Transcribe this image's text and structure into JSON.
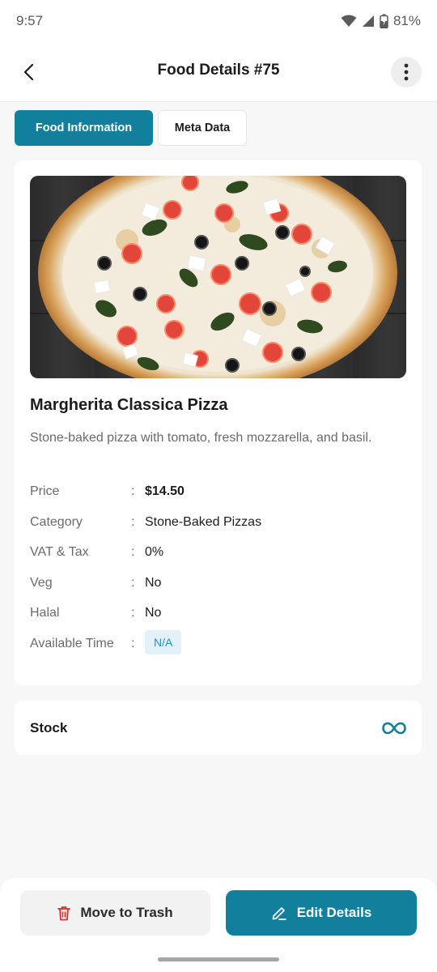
{
  "status_bar": {
    "time": "9:57",
    "battery": "81%"
  },
  "app_bar": {
    "title": "Food Details #75"
  },
  "tabs": [
    {
      "label": "Food Information",
      "active": true
    },
    {
      "label": "Meta Data",
      "active": false
    }
  ],
  "food": {
    "name": "Margherita Classica Pizza",
    "description": "Stone-baked pizza with tomato, fresh mozzarella, and basil.",
    "details": [
      {
        "label": "Price",
        "value": "$14.50"
      },
      {
        "label": "Category",
        "value": "Stone-Baked Pizzas"
      },
      {
        "label": "VAT & Tax",
        "value": "0%"
      },
      {
        "label": "Veg",
        "value": "No"
      },
      {
        "label": "Halal",
        "value": "No"
      },
      {
        "label": "Available Time",
        "value": "N/A"
      }
    ],
    "separator": ":"
  },
  "stock": {
    "label": "Stock",
    "icon": "infinity-icon"
  },
  "actions": {
    "trash_label": "Move to Trash",
    "edit_label": "Edit Details"
  },
  "colors": {
    "primary": "#127f9c",
    "danger": "#d9302c",
    "badge_bg": "#e2f1fa",
    "badge_text": "#2d8fc0"
  }
}
